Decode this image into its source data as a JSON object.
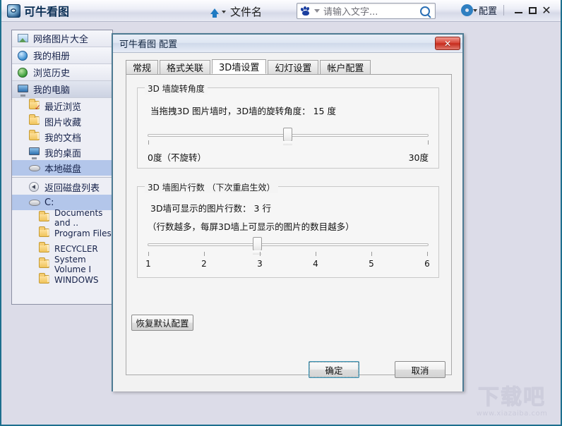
{
  "app": {
    "brand": "可牛看图",
    "center_filename": "文件名",
    "search": {
      "placeholder": "请输入文字...",
      "icon": "baidu-paw-icon",
      "search_icon": "magnifier-icon"
    },
    "config_label": "配置",
    "window_controls": {
      "minimize": "－",
      "maximize": "□",
      "close": "✕"
    }
  },
  "sidebar": {
    "nav": [
      {
        "label": "网络图片大全",
        "icon": "picture-icon",
        "selected": false
      },
      {
        "label": "我的相册",
        "icon": "globe-blue-icon",
        "selected": false
      },
      {
        "label": "浏览历史",
        "icon": "globe-green-icon",
        "selected": false
      },
      {
        "label": "我的电脑",
        "icon": "monitor-icon",
        "selected": true
      }
    ],
    "tree": [
      {
        "label": "最近浏览",
        "icon": "folder-check-icon",
        "selected": false
      },
      {
        "label": "图片收藏",
        "icon": "folder-icon",
        "selected": false
      },
      {
        "label": "我的文档",
        "icon": "folder-icon",
        "selected": false
      },
      {
        "label": "我的桌面",
        "icon": "desktop-icon",
        "selected": false
      },
      {
        "label": "本地磁盘",
        "icon": "disk-icon",
        "selected": true
      }
    ],
    "back_label": "返回磁盘列表",
    "drive": {
      "label": "C:",
      "icon": "disk-icon",
      "selected": true
    },
    "folders": [
      {
        "label": "Documents and ..",
        "icon": "folder-icon"
      },
      {
        "label": "Program Files",
        "icon": "folder-icon"
      },
      {
        "label": "RECYCLER",
        "icon": "folder-icon"
      },
      {
        "label": "System Volume I",
        "icon": "folder-icon"
      },
      {
        "label": "WINDOWS",
        "icon": "folder-icon"
      }
    ]
  },
  "dialog": {
    "title": "可牛看图 配置",
    "close_glyph": "✕",
    "tabs": [
      {
        "label": "常规",
        "active": false
      },
      {
        "label": "格式关联",
        "active": false
      },
      {
        "label": "3D墙设置",
        "active": true
      },
      {
        "label": "幻灯设置",
        "active": false
      },
      {
        "label": "帐户配置",
        "active": false
      }
    ],
    "group_rotation": {
      "legend": "3D 墙旋转角度",
      "description": "当拖拽3D 图片墙时，3D墙的旋转角度：  15  度",
      "value": "15",
      "min_label": "0度（不旋转）",
      "max_label": "30度",
      "slider": {
        "min": 0,
        "max": 30,
        "value": 15,
        "percent": 50
      }
    },
    "group_rows": {
      "legend": "3D 墙图片行数 （下次重启生效）",
      "description": "3D墙可显示的图片行数： 3 行",
      "hint": "（行数越多，每屏3D墙上可显示的图片的数目越多）",
      "value": "3",
      "slider": {
        "min": 1,
        "max": 6,
        "value": 3,
        "percent": 40
      },
      "ticks": [
        "1",
        "2",
        "3",
        "4",
        "5",
        "6"
      ]
    },
    "buttons": {
      "restore_default": "恢复默认配置",
      "ok": "确定",
      "cancel": "取消"
    }
  },
  "watermark": {
    "big": "下载吧",
    "url": "www.xiazaiba.com"
  }
}
